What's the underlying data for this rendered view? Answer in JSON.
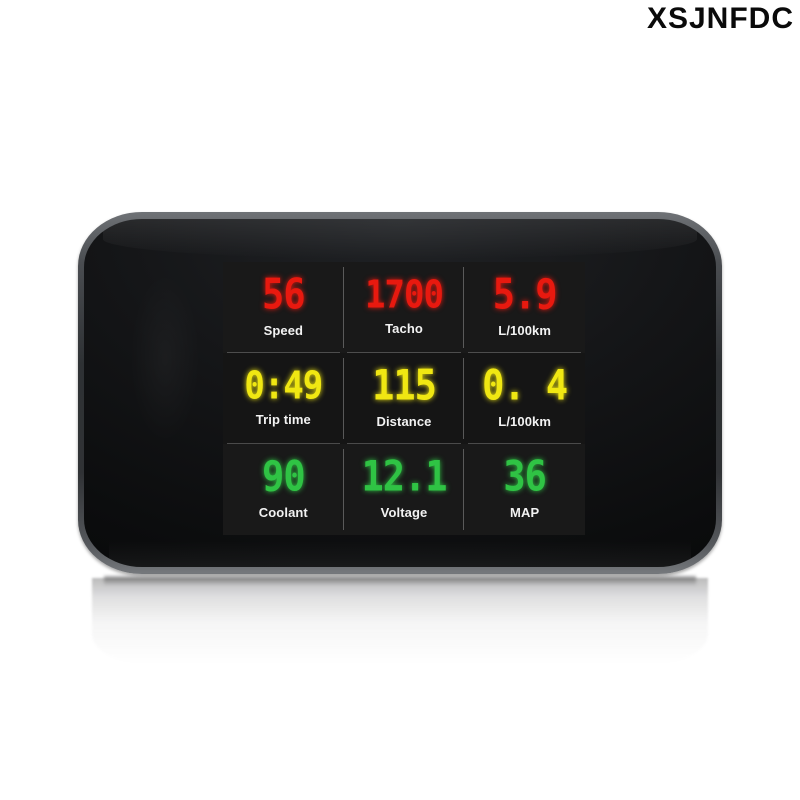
{
  "watermark": {
    "text": "XSJNFDC"
  },
  "device": {
    "name": "car-hud-obd-display",
    "screen": {
      "cells": [
        {
          "value": "56",
          "label": "Speed",
          "color": "#e8190f",
          "name": "speed"
        },
        {
          "value": "1700",
          "label": "Tacho",
          "color": "#e8190f",
          "name": "tacho"
        },
        {
          "value": "5.9",
          "label": "L/100km",
          "color": "#e8190f",
          "name": "fuel-consumption-instant"
        },
        {
          "value": "0:49",
          "label": "Trip time",
          "color": "#f0e712",
          "name": "trip-time"
        },
        {
          "value": "115",
          "label": "Distance",
          "color": "#f0e712",
          "name": "distance"
        },
        {
          "value": "0. 4",
          "label": "L/100km",
          "color": "#f0e712",
          "name": "fuel-consumption-average"
        },
        {
          "value": "90",
          "label": "Coolant",
          "color": "#2fc344",
          "name": "coolant-temperature"
        },
        {
          "value": "12.1",
          "label": "Voltage",
          "color": "#2fc344",
          "name": "battery-voltage"
        },
        {
          "value": "36",
          "label": "MAP",
          "color": "#2fc344",
          "name": "manifold-absolute-pressure"
        }
      ]
    },
    "colors": {
      "red": "#e8190f",
      "yellow": "#f0e712",
      "green": "#2fc344",
      "screen_background": "#171717",
      "bezel": "#0c0d0e",
      "rim": "#5a5d61"
    }
  }
}
